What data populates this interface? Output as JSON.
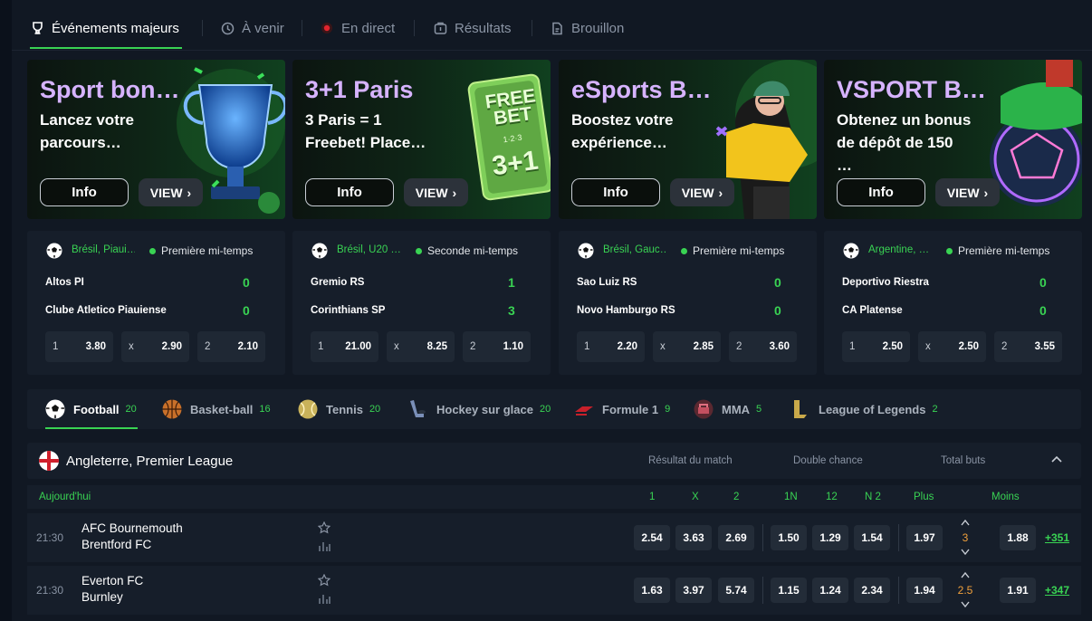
{
  "tabs": [
    {
      "label": "Événements majeurs",
      "icon": "trophy-icon"
    },
    {
      "label": "À venir",
      "icon": "clock-icon"
    },
    {
      "label": "En direct",
      "icon": "live-dot-icon"
    },
    {
      "label": "Résultats",
      "icon": "results-icon"
    },
    {
      "label": "Brouillon",
      "icon": "draft-icon"
    }
  ],
  "banners": [
    {
      "title": "Sport bon…",
      "subtitle": "Lancez votre parcours…",
      "info": "Info",
      "view": "VIEW",
      "art": "trophy-art"
    },
    {
      "title": "3+1 Paris",
      "subtitle": "3 Paris = 1 Freebet! Place…",
      "info": "Info",
      "view": "VIEW",
      "art": "freebet-card-art",
      "art_text": "FREE BET",
      "art_sub": "1·2·3",
      "art_big": "3+1"
    },
    {
      "title": "eSports B…",
      "subtitle": "Boostez votre expérience…",
      "info": "Info",
      "view": "VIEW",
      "art": "esports-character-art"
    },
    {
      "title": "VSPORT B…",
      "subtitle": "Obtenez un bonus de dépôt de 150 …",
      "info": "Info",
      "view": "VIEW",
      "art": "football-boot-art"
    }
  ],
  "live": [
    {
      "competition": "Brésil, Piaui…",
      "status": "Première mi-temps",
      "home": "Altos PI",
      "away": "Clube Atletico Piauiense",
      "home_score": "0",
      "away_score": "0",
      "odds": [
        {
          "l": "1",
          "v": "3.80"
        },
        {
          "l": "x",
          "v": "2.90"
        },
        {
          "l": "2",
          "v": "2.10"
        }
      ]
    },
    {
      "competition": "Brésil, U20 …",
      "status": "Seconde mi-temps",
      "home": "Gremio RS",
      "away": "Corinthians SP",
      "home_score": "1",
      "away_score": "3",
      "odds": [
        {
          "l": "1",
          "v": "21.00"
        },
        {
          "l": "x",
          "v": "8.25"
        },
        {
          "l": "2",
          "v": "1.10"
        }
      ]
    },
    {
      "competition": "Brésil, Gauc…",
      "status": "Première mi-temps",
      "home": "Sao Luiz RS",
      "away": "Novo Hamburgo RS",
      "home_score": "0",
      "away_score": "0",
      "odds": [
        {
          "l": "1",
          "v": "2.20"
        },
        {
          "l": "x",
          "v": "2.85"
        },
        {
          "l": "2",
          "v": "3.60"
        }
      ]
    },
    {
      "competition": "Argentine, …",
      "status": "Première mi-temps",
      "home": "Deportivo Riestra",
      "away": "CA Platense",
      "home_score": "0",
      "away_score": "0",
      "odds": [
        {
          "l": "1",
          "v": "2.50"
        },
        {
          "l": "x",
          "v": "2.50"
        },
        {
          "l": "2",
          "v": "3.55"
        }
      ]
    }
  ],
  "sports": [
    {
      "label": "Football",
      "count": "20",
      "icon": "football-icon",
      "color": "#ffffff"
    },
    {
      "label": "Basket-ball",
      "count": "16",
      "icon": "basketball-icon",
      "color": "#c8702a"
    },
    {
      "label": "Tennis",
      "count": "20",
      "icon": "tennis-icon",
      "color": "#c9b25a"
    },
    {
      "label": "Hockey sur glace",
      "count": "20",
      "icon": "hockey-icon",
      "color": "#7a8fb8"
    },
    {
      "label": "Formule 1",
      "count": "9",
      "icon": "formula1-icon",
      "color": "#c8202a"
    },
    {
      "label": "MMA",
      "count": "5",
      "icon": "mma-icon",
      "color": "#a8404a"
    },
    {
      "label": "League of Legends",
      "count": "2",
      "icon": "lol-icon",
      "color": "#c9a94a"
    }
  ],
  "league": {
    "name": "Angleterre, Premier League",
    "headers": [
      "Résultat du match",
      "Double chance",
      "Total buts"
    ],
    "day": "Aujourd'hui",
    "columns": [
      "1",
      "X",
      "2",
      "1N",
      "12",
      "N 2",
      "Plus",
      "Moins"
    ]
  },
  "matches": [
    {
      "time": "21:30",
      "home": "AFC Bournemouth",
      "away": "Brentford FC",
      "odds": [
        "2.54",
        "3.63",
        "2.69",
        "1.50",
        "1.29",
        "1.54",
        "1.97",
        "1.88"
      ],
      "line": "3",
      "more": "+351"
    },
    {
      "time": "21:30",
      "home": "Everton FC",
      "away": "Burnley",
      "odds": [
        "1.63",
        "3.97",
        "5.74",
        "1.15",
        "1.24",
        "2.34",
        "1.94",
        "1.91"
      ],
      "line": "2.5",
      "more": "+347"
    }
  ],
  "colors": {
    "accent": "#39d353",
    "banner_title": "#d6b3ff",
    "total_line": "#f0a03c"
  }
}
